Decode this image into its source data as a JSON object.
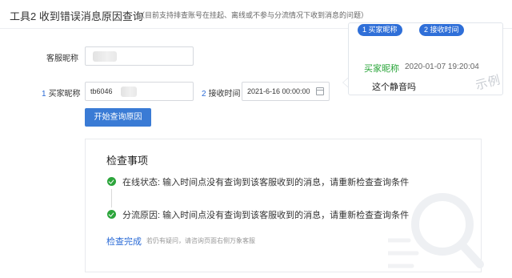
{
  "header": {
    "title": "工具2 收到错误消息原因查询",
    "subtitle": "（目前支持排查账号在挂起、离线或不参与分流情况下收到消息的问题）"
  },
  "form": {
    "kefu_label": "客服昵称",
    "buyer_num": "1",
    "buyer_label": "买家昵称",
    "buyer_value": "tb6046",
    "time_num": "2",
    "time_label": "接收时间",
    "time_value": "2021-6-16 00:00:00",
    "submit_label": "开始查询原因"
  },
  "example_tip": {
    "pill_1": "1 买家昵称",
    "pill_2": "2 接收时间",
    "nickname": "买家昵称",
    "time": "2020-01-07  19:20:04",
    "message": "这个静音吗",
    "watermark": "示例"
  },
  "result": {
    "title": "检查事项",
    "items": [
      {
        "label": "在线状态: 输入时间点没有查询到该客服收到的消息，请重新检查查询条件"
      },
      {
        "label": "分流原因: 输入时间点没有查询到该客服收到的消息，请重新检查查询条件"
      }
    ],
    "done_label": "检查完成",
    "done_note": "若仍有疑问，请咨询页面右侧万象客服"
  },
  "colors": {
    "accent": "#3a7bd5",
    "success": "#2ca53b",
    "nickname_green": "#2aa53a"
  }
}
